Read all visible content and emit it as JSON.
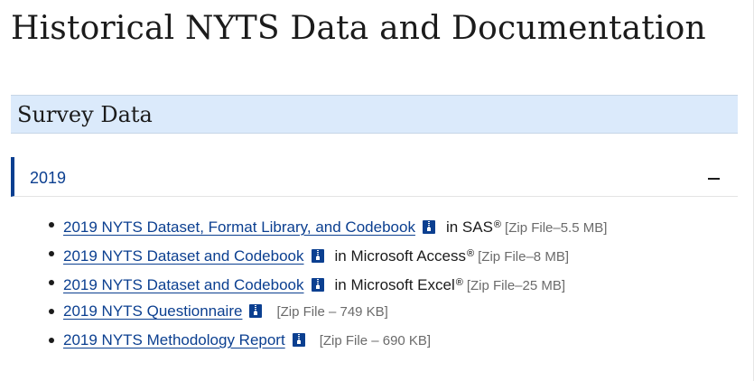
{
  "page": {
    "title": "Historical NYTS Data and Documentation"
  },
  "section": {
    "title": "Survey Data"
  },
  "accordion": {
    "label": "2019",
    "state": "expanded",
    "icon": "minus-icon"
  },
  "files": [
    {
      "link": "2019 NYTS Dataset, Format Library, and Codebook",
      "format": "in SAS",
      "registered": "®",
      "size": "[Zip File–5.5 MB]",
      "icon": "zip-file-icon"
    },
    {
      "link": "2019 NYTS Dataset and Codebook",
      "format": "in Microsoft Access",
      "registered": "®",
      "size": "[Zip File–8 MB]",
      "icon": "zip-file-icon"
    },
    {
      "link": "2019 NYTS Dataset and Codebook",
      "format": "in Microsoft Excel",
      "registered": "®",
      "size": "[Zip File–25 MB]",
      "icon": "zip-file-icon"
    },
    {
      "link": "2019 NYTS Questionnaire",
      "format": "",
      "registered": "",
      "size": "[Zip File – 749 KB]",
      "icon": "zip-file-icon"
    },
    {
      "link": "2019 NYTS Methodology Report",
      "format": "",
      "registered": "",
      "size": "[Zip File – 690 KB]",
      "icon": "zip-file-icon"
    }
  ],
  "colors": {
    "link": "#0b3f90",
    "section_bg": "#dbeafb",
    "accordion_accent": "#0b3f90",
    "muted_text": "#6b6b6b"
  }
}
